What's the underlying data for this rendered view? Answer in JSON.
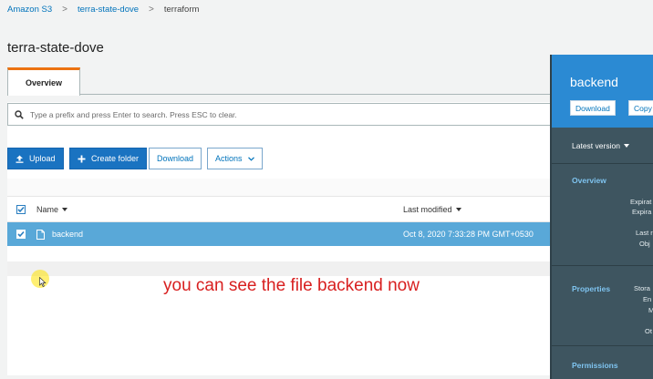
{
  "breadcrumb": {
    "root": "Amazon S3",
    "bucket": "terra-state-dove",
    "folder": "terraform"
  },
  "page_title": "terra-state-dove",
  "tabs": [
    {
      "label": "Overview"
    }
  ],
  "search": {
    "placeholder": "Type a prefix and press Enter to search. Press ESC to clear."
  },
  "toolbar": {
    "upload": "Upload",
    "create_folder": "Create folder",
    "download": "Download",
    "actions": "Actions"
  },
  "table": {
    "columns": {
      "name": "Name",
      "last_modified": "Last modified"
    },
    "rows": [
      {
        "name": "backend",
        "last_modified": "Oct 8, 2020 7:33:28 PM GMT+0530",
        "selected": true
      }
    ]
  },
  "caption": "you can see the file backend now",
  "side_panel": {
    "title": "backend",
    "download": "Download",
    "copy": "Copy",
    "version": "Latest version",
    "sections": {
      "overview": "Overview",
      "properties": "Properties",
      "permissions": "Permissions"
    },
    "overview_lines": [
      "Expirat",
      "Expira",
      "Last r",
      "Obj"
    ],
    "properties_lines": [
      "Stora",
      "En",
      "M",
      "Ot"
    ]
  },
  "colors": {
    "accent": "#ec7211",
    "primary": "#1a73c1",
    "selected_row": "#59a8d8",
    "side_bg": "#3e5560",
    "side_header": "#2b8ad3",
    "caption": "#d82020"
  }
}
